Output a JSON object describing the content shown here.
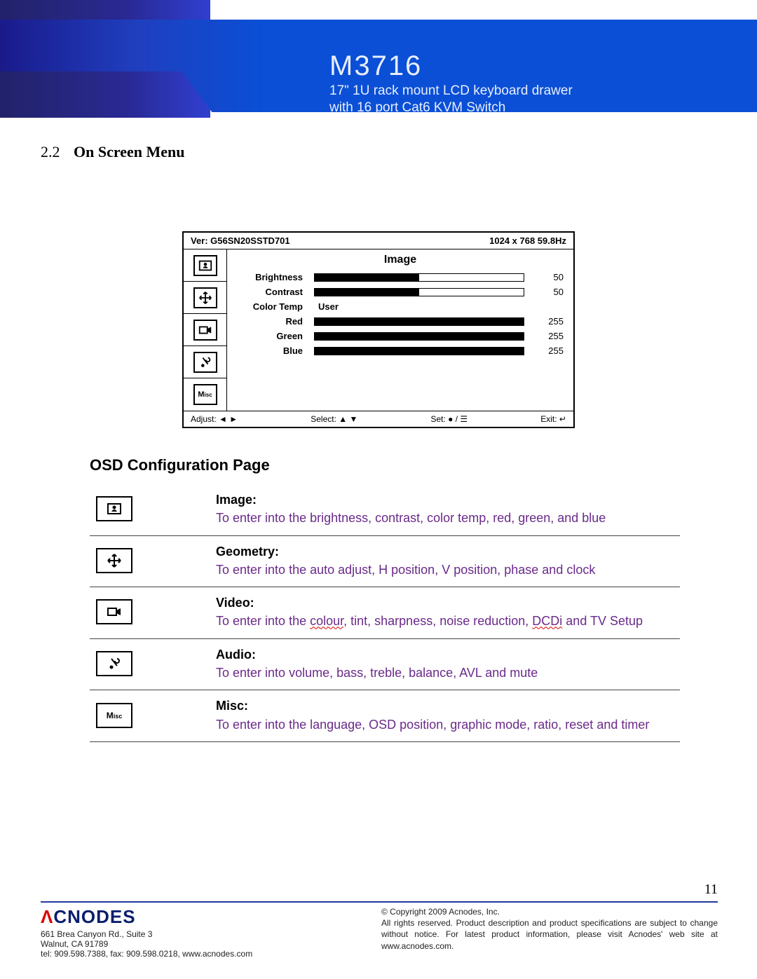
{
  "banner": {
    "title": "M3716",
    "subtitle": "17\" 1U rack mount LCD keyboard drawer\nwith 16 port Cat6 KVM Switch"
  },
  "section": {
    "number": "2.2",
    "title": "On Screen Menu"
  },
  "osd": {
    "version_label": "Ver: G56SN20SSTD701",
    "resolution": "1024 x 768  59.8Hz",
    "heading": "Image",
    "rows": [
      {
        "label": "Brightness",
        "value": "50",
        "fill_pct": 50
      },
      {
        "label": "Contrast",
        "value": "50",
        "fill_pct": 50
      },
      {
        "label": "Color Temp",
        "text_value": "User"
      },
      {
        "label": "Red",
        "value": "255",
        "fill_pct": 100
      },
      {
        "label": "Green",
        "value": "255",
        "fill_pct": 100
      },
      {
        "label": "Blue",
        "value": "255",
        "fill_pct": 100
      }
    ],
    "footer": {
      "adjust": "Adjust: ◄ ►",
      "select": "Select: ▲ ▼",
      "set": "Set: ● / ☰",
      "exit": "Exit: ↵"
    },
    "nav_misc_label": "Misc"
  },
  "config": {
    "title": "OSD Configuration Page",
    "rows": [
      {
        "icon": "image",
        "heading": "Image:",
        "desc_html": "To enter into the brightness, contrast, color temp, red, green, and blue"
      },
      {
        "icon": "geometry",
        "heading": "Geometry:",
        "desc_html": "To enter into the auto adjust, H position, V position, phase and clock"
      },
      {
        "icon": "video",
        "heading": "Video:",
        "desc_html": "To enter into the <span class='underline-wavy'>colour</span>, tint, sharpness, noise reduction, <span class='underline-wavy'>DCDi</span> and TV Setup"
      },
      {
        "icon": "audio",
        "heading": "Audio:",
        "desc_html": "To enter into volume, bass, treble, balance, AVL and mute"
      },
      {
        "icon": "misc",
        "heading": "Misc:",
        "desc_html": "To enter into the language, OSD position, graphic mode, ratio, reset and timer",
        "misc_label": "Misc"
      }
    ]
  },
  "page_number": "11",
  "footer": {
    "logo_text": "CNODES",
    "addr1": "661 Brea Canyon Rd., Suite 3",
    "addr2": "Walnut, CA 91789",
    "contact": "tel: 909.598.7388, fax: 909.598.0218, www.acnodes.com",
    "copyright": "© Copyright 2009 Acnodes, Inc.",
    "legal": "All rights reserved. Product description and product specifications are subject to change without notice. For latest product information, please visit Acnodes' web site at www.acnodes.com."
  }
}
